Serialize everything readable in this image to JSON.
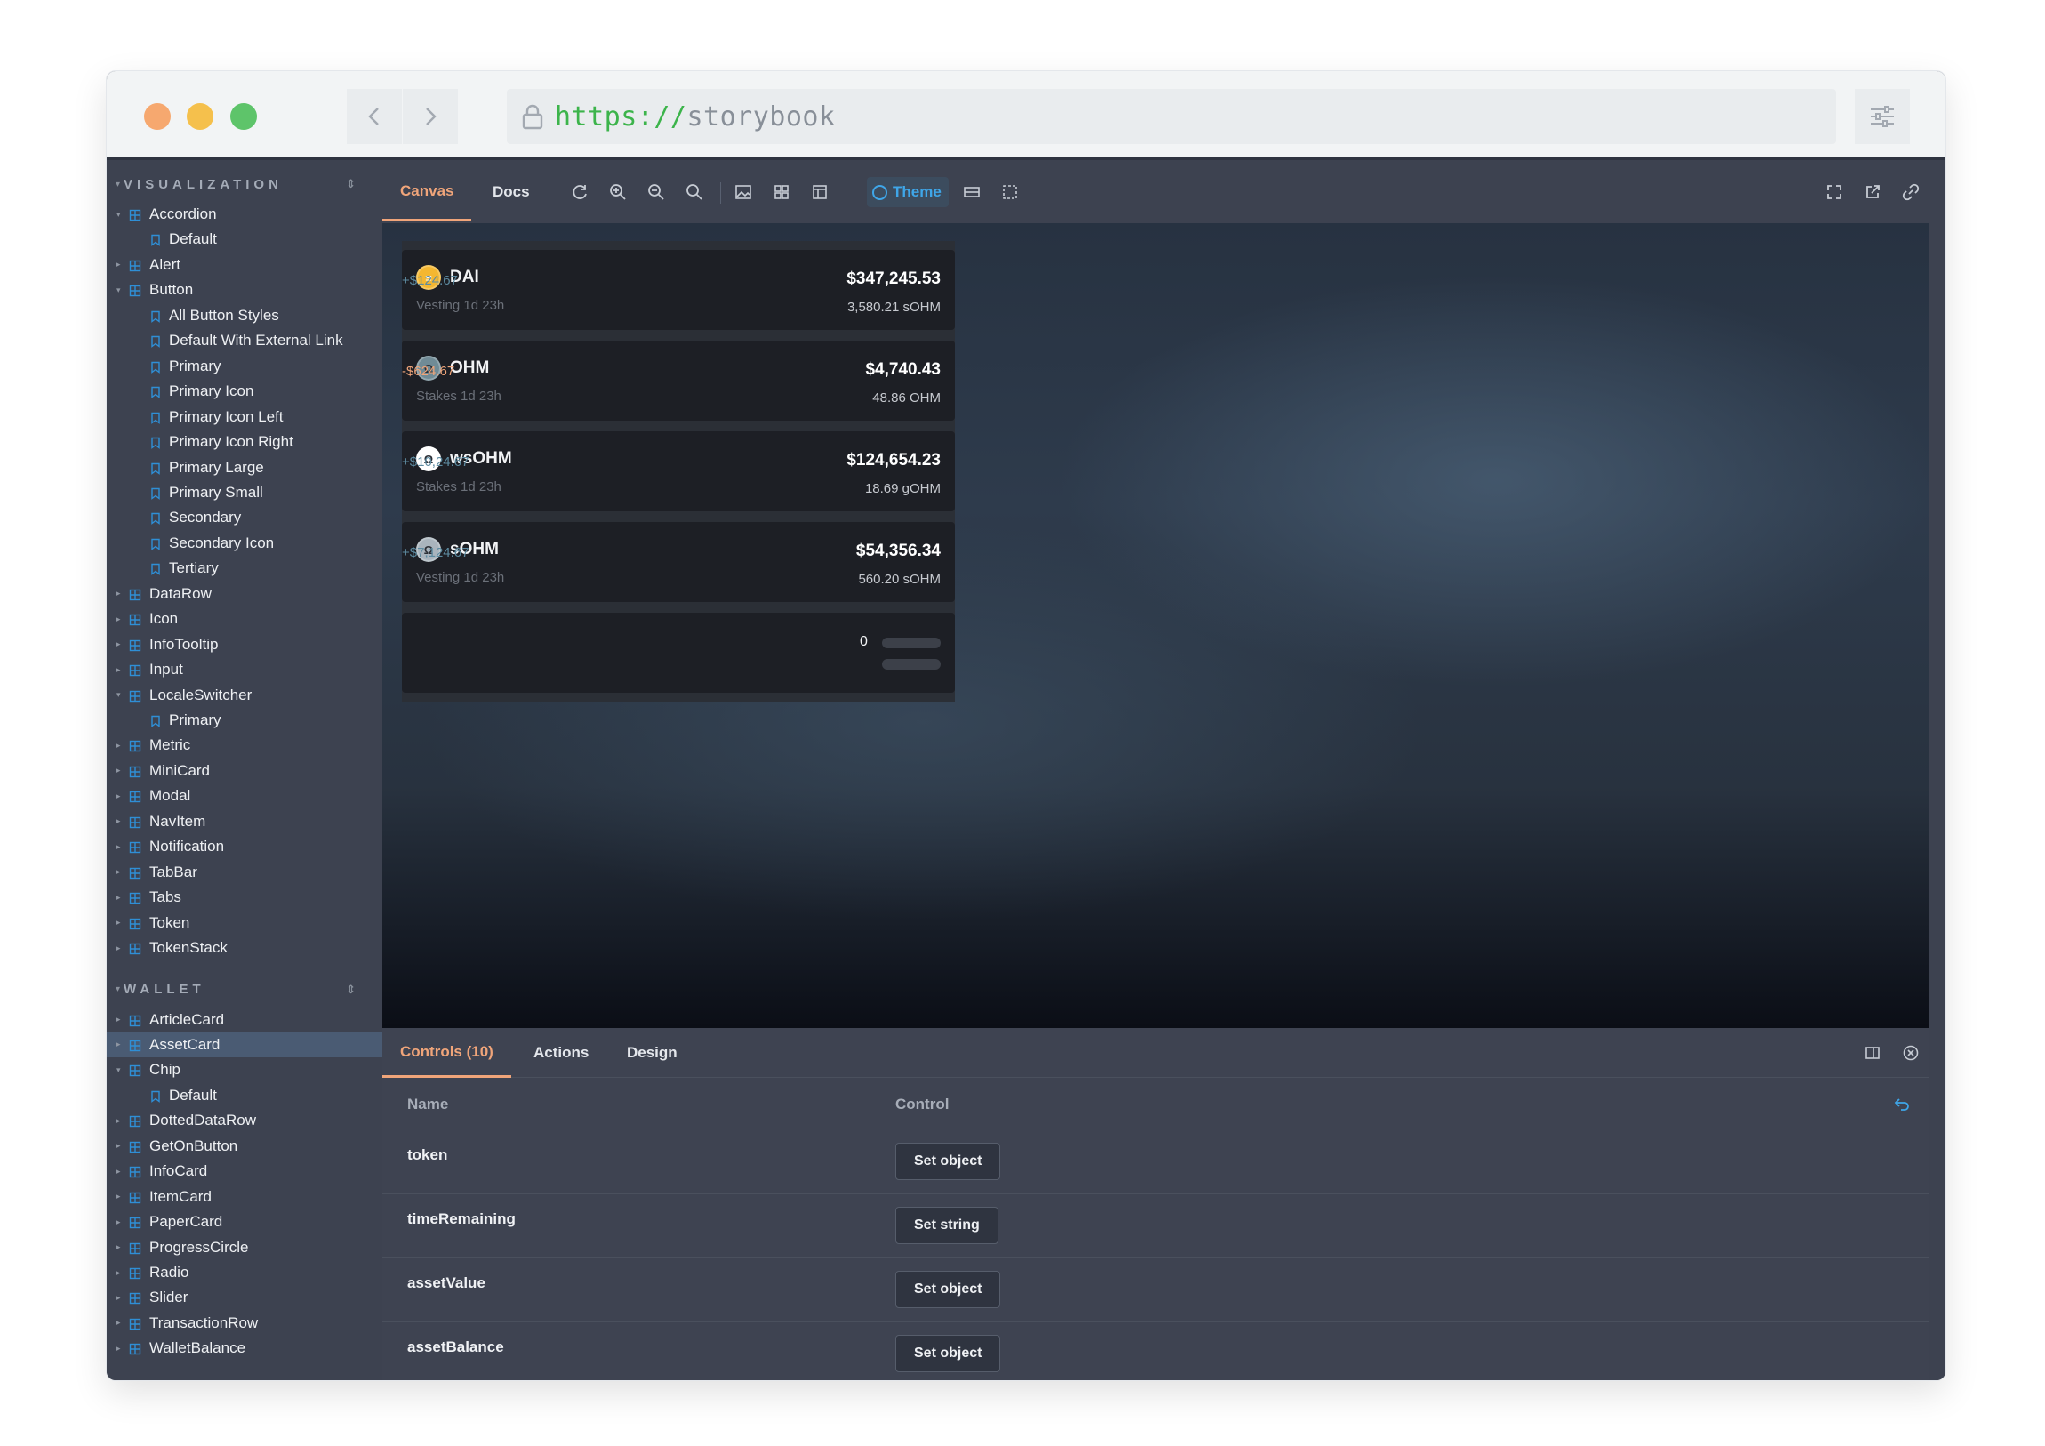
{
  "browser": {
    "url_protocol": "https://",
    "url_host": "storybook",
    "lights": {
      "close": "#f6a86f",
      "minimize": "#f5c04c",
      "maximize": "#5ec46a"
    }
  },
  "sidebar": {
    "groups": [
      {
        "title": "VISUALIZATION",
        "items": [
          {
            "label": "Accordion",
            "kind": "component",
            "expanded": true
          },
          {
            "label": "Default",
            "kind": "story"
          },
          {
            "label": "Alert",
            "kind": "component"
          },
          {
            "label": "Button",
            "kind": "component",
            "expanded": true
          },
          {
            "label": "All Button Styles",
            "kind": "story"
          },
          {
            "label": "Default With External Link",
            "kind": "story"
          },
          {
            "label": "Primary",
            "kind": "story"
          },
          {
            "label": "Primary Icon",
            "kind": "story"
          },
          {
            "label": "Primary Icon Left",
            "kind": "story"
          },
          {
            "label": "Primary Icon Right",
            "kind": "story"
          },
          {
            "label": "Primary Large",
            "kind": "story"
          },
          {
            "label": "Primary Small",
            "kind": "story"
          },
          {
            "label": "Secondary",
            "kind": "story"
          },
          {
            "label": "Secondary Icon",
            "kind": "story"
          },
          {
            "label": "Tertiary",
            "kind": "story"
          },
          {
            "label": "DataRow",
            "kind": "component"
          },
          {
            "label": "Icon",
            "kind": "component"
          },
          {
            "label": "InfoTooltip",
            "kind": "component"
          },
          {
            "label": "Input",
            "kind": "component"
          },
          {
            "label": "LocaleSwitcher",
            "kind": "component",
            "expanded": true
          },
          {
            "label": "Primary",
            "kind": "story"
          },
          {
            "label": "Metric",
            "kind": "component"
          },
          {
            "label": "MiniCard",
            "kind": "component"
          },
          {
            "label": "Modal",
            "kind": "component"
          },
          {
            "label": "NavItem",
            "kind": "component"
          },
          {
            "label": "Notification",
            "kind": "component"
          },
          {
            "label": "TabBar",
            "kind": "component"
          },
          {
            "label": "Tabs",
            "kind": "component"
          },
          {
            "label": "Token",
            "kind": "component"
          },
          {
            "label": "TokenStack",
            "kind": "component"
          }
        ]
      },
      {
        "title": "WALLET",
        "items": [
          {
            "label": "ArticleCard",
            "kind": "component"
          },
          {
            "label": "AssetCard",
            "kind": "component",
            "selected": true
          },
          {
            "label": "Chip",
            "kind": "component",
            "expanded": true
          },
          {
            "label": "Default",
            "kind": "story"
          },
          {
            "label": "DottedDataRow",
            "kind": "component"
          },
          {
            "label": "GetOnButton",
            "kind": "component"
          },
          {
            "label": "InfoCard",
            "kind": "component"
          },
          {
            "label": "ItemCard",
            "kind": "component"
          },
          {
            "label": "PaperCard",
            "kind": "component"
          },
          {
            "label": "ProgressCircle",
            "kind": "component"
          },
          {
            "label": "Radio",
            "kind": "component"
          },
          {
            "label": "Slider",
            "kind": "component"
          },
          {
            "label": "TransactionRow",
            "kind": "component"
          },
          {
            "label": "WalletBalance",
            "kind": "component"
          }
        ]
      }
    ]
  },
  "toolbar": {
    "tab_canvas": "Canvas",
    "tab_docs": "Docs",
    "theme_label": "Theme"
  },
  "canvas": {
    "assets": [
      {
        "symbol": "DAI",
        "subtitle": "Vesting 1d 23h",
        "change": "+$124.67",
        "change_dir": "up",
        "value": "$347,245.53",
        "balance": "3,580.21 sOHM",
        "icon": "dai-token-icon",
        "icon_color": "#f4b731"
      },
      {
        "symbol": "OHM",
        "subtitle": "Stakes 1d 23h",
        "change": "-$624.67",
        "change_dir": "down",
        "value": "$4,740.43",
        "balance": "48.86 OHM",
        "icon": "ohm-token-icon",
        "icon_color": "#708b96"
      },
      {
        "symbol": "wsOHM",
        "subtitle": "Stakes 1d 23h",
        "change": "+$10,24.67",
        "change_dir": "up",
        "value": "$124,654.23",
        "balance": "18.69 gOHM",
        "icon": "wsohm-token-icon",
        "icon_color": "#ffffff"
      },
      {
        "symbol": "sOHM",
        "subtitle": "Vesting 1d 23h",
        "change": "+$7,124.67",
        "change_dir": "up",
        "value": "$54,356.34",
        "balance": "560.20 sOHM",
        "icon": "sohm-token-icon",
        "icon_color": "#a9b4bd"
      }
    ],
    "loading_value": "0",
    "colors": {
      "positive": "#5d8ba1",
      "negative": "#f0a57a"
    }
  },
  "panel": {
    "tab_controls": "Controls (10)",
    "tab_actions": "Actions",
    "tab_design": "Design",
    "col_name": "Name",
    "col_control": "Control",
    "controls": [
      {
        "name": "token",
        "button": "Set object"
      },
      {
        "name": "timeRemaining",
        "button": "Set string"
      },
      {
        "name": "assetValue",
        "button": "Set object"
      },
      {
        "name": "assetBalance",
        "button": "Set object"
      }
    ]
  }
}
